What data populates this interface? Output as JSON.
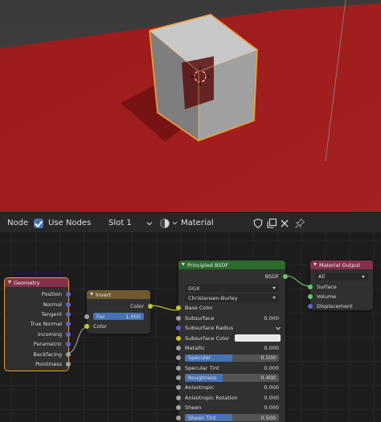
{
  "header": {
    "editor_type": "Node",
    "use_nodes_label": "Use Nodes",
    "slot": "Slot 1",
    "material": "Material"
  },
  "icons": [
    "node-editor-icon",
    "checkbox-icon",
    "chevron-down-icon",
    "material-sphere-icon",
    "shield-icon",
    "copy-icon",
    "close-icon",
    "pin-icon"
  ],
  "colors": {
    "floor": "#a11d1d",
    "geometry_header": "#83314a",
    "invert_header": "#6e5a2e",
    "bsdf_header": "#2b6b2b",
    "output_header": "#83314a",
    "selection": "#f0a030"
  },
  "nodes": {
    "geometry": {
      "title": "Geometry",
      "outputs": [
        "Position",
        "Normal",
        "Tangent",
        "True Normal",
        "Incoming",
        "Parametric",
        "Backfacing",
        "Pointiness"
      ]
    },
    "invert": {
      "title": "Invert",
      "output": "Color",
      "fac_label": "Fac",
      "fac_value": "1.000",
      "input": "Color"
    },
    "bsdf": {
      "title": "Principled BSDF",
      "output": "BSDF",
      "distribution": "GGX",
      "subsurface_method": "Christensen-Burley",
      "rows": [
        {
          "label": "Base Color",
          "value": ""
        },
        {
          "label": "Subsurface",
          "value": "0.000"
        },
        {
          "label": "Subsurface Radius",
          "value": ""
        },
        {
          "label": "Subsurface Color",
          "value": ""
        },
        {
          "label": "Metallic",
          "value": "0.000"
        },
        {
          "label": "Specular",
          "value": "0.500"
        },
        {
          "label": "Specular Tint",
          "value": "0.000"
        },
        {
          "label": "Roughness",
          "value": "0.400"
        },
        {
          "label": "Anisotropic",
          "value": "0.000"
        },
        {
          "label": "Anisotropic Rotation",
          "value": "0.000"
        },
        {
          "label": "Sheen",
          "value": "0.000"
        },
        {
          "label": "Sheen Tint",
          "value": "0.500"
        }
      ]
    },
    "output": {
      "title": "Material Output",
      "target": "All",
      "inputs": [
        "Surface",
        "Volume",
        "Displacement"
      ]
    }
  }
}
